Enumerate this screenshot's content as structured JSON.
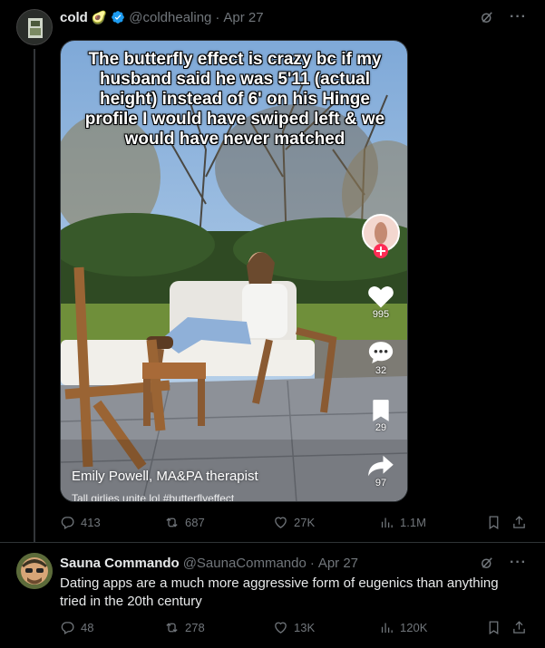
{
  "post1": {
    "display_name": "cold",
    "emoji": "🥑",
    "handle": "@coldhealing",
    "separator": "·",
    "date": "Apr 27",
    "media": {
      "caption": "The butterfly effect is crazy bc if my husband said he was 5'11 (actual height) instead of 6' on his Hinge profile I would have swiped left & we would have never matched",
      "author": "Emily Powell, MA&PA therapist",
      "tags": "Tall girlies unite lol #butterflyeffect",
      "likes": "995",
      "comments": "32",
      "saves": "29",
      "shares": "97"
    },
    "actions": {
      "replies": "413",
      "reposts": "687",
      "likes": "27K",
      "views": "1.1M"
    }
  },
  "post2": {
    "display_name": "Sauna Commando",
    "handle": "@SaunaCommando",
    "separator": "·",
    "date": "Apr 27",
    "text": "Dating apps are a much more aggressive form of eugenics than anything tried in the 20th century",
    "actions": {
      "replies": "48",
      "reposts": "278",
      "likes": "13K",
      "views": "120K"
    }
  },
  "colors": {
    "background": "#000000",
    "text": "#e7e9ea",
    "muted": "#71767b",
    "verified": "#1d9bf0",
    "divider": "#2f3336",
    "tiktok_red": "#fe2c55"
  },
  "icons": [
    "grok-icon",
    "more-icon",
    "reply-icon",
    "repost-icon",
    "like-icon",
    "views-icon",
    "bookmark-icon",
    "share-icon",
    "verified-badge-icon",
    "heart-icon",
    "comment-icon",
    "save-icon",
    "share-arrow-icon"
  ]
}
